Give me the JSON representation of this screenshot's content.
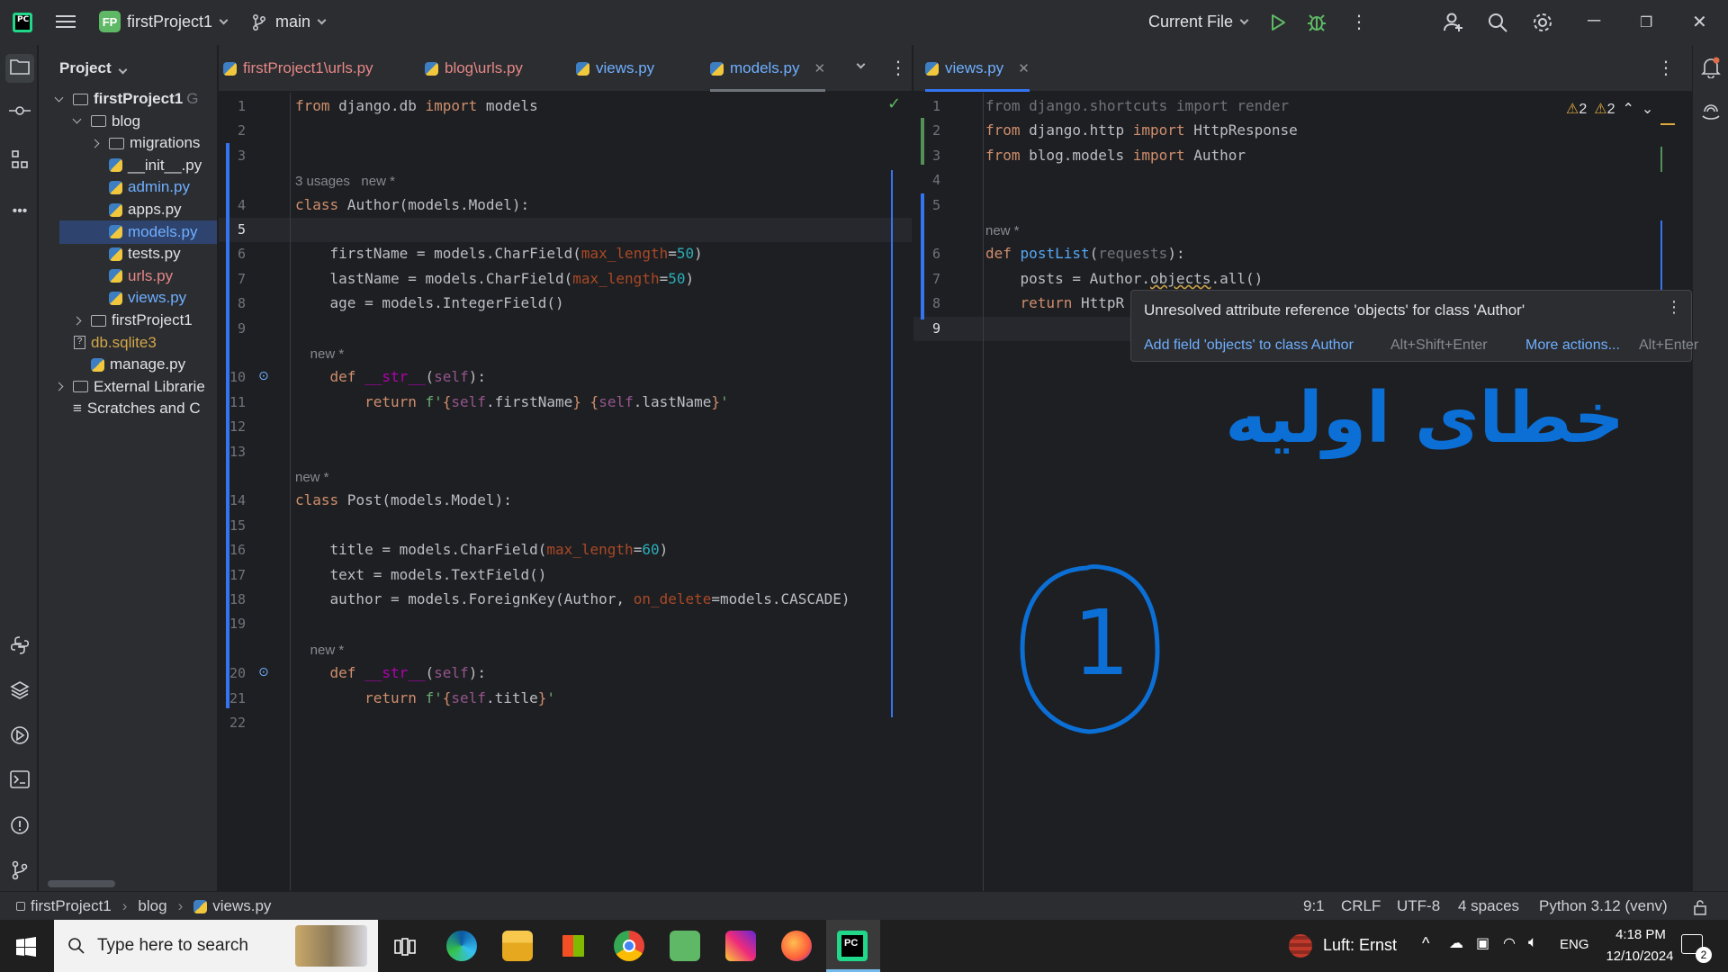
{
  "titlebar": {
    "project_badge": "FP",
    "project_name": "firstProject1",
    "branch": "main",
    "run_config": "Current File"
  },
  "project_panel": {
    "title": "Project",
    "tree": [
      {
        "label": "firstProject1",
        "suffix": "G",
        "level": 0,
        "kind": "folder",
        "expanded": true,
        "color": "normal",
        "bold": true
      },
      {
        "label": "blog",
        "level": 1,
        "kind": "folder",
        "expanded": true,
        "color": "normal"
      },
      {
        "label": "migrations",
        "level": 2,
        "kind": "folder",
        "expanded": false,
        "color": "normal"
      },
      {
        "label": "__init__.py",
        "level": 2,
        "kind": "py",
        "color": "normal"
      },
      {
        "label": "admin.py",
        "level": 2,
        "kind": "py",
        "color": "blue"
      },
      {
        "label": "apps.py",
        "level": 2,
        "kind": "py",
        "color": "normal"
      },
      {
        "label": "models.py",
        "level": 2,
        "kind": "py",
        "color": "blue",
        "selected": true
      },
      {
        "label": "tests.py",
        "level": 2,
        "kind": "py",
        "color": "normal"
      },
      {
        "label": "urls.py",
        "level": 2,
        "kind": "py",
        "color": "red"
      },
      {
        "label": "views.py",
        "level": 2,
        "kind": "py",
        "color": "blue"
      },
      {
        "label": "firstProject1",
        "level": 1,
        "kind": "folder",
        "expanded": false,
        "color": "normal"
      },
      {
        "label": "db.sqlite3",
        "level": 1,
        "kind": "db",
        "color": "gold"
      },
      {
        "label": "manage.py",
        "level": 1,
        "kind": "py",
        "color": "normal"
      },
      {
        "label": "External Librarie",
        "level": 0,
        "kind": "lib",
        "expanded": false,
        "color": "normal"
      },
      {
        "label": "Scratches and C",
        "level": 0,
        "kind": "scratch",
        "color": "normal"
      }
    ]
  },
  "editor_left": {
    "tabs": [
      {
        "label": "firstProject1\\urls.py",
        "color": "red"
      },
      {
        "label": "blog\\urls.py",
        "color": "red"
      },
      {
        "label": "views.py",
        "color": "blue"
      },
      {
        "label": "models.py",
        "color": "blue",
        "active": true,
        "close": "✕"
      }
    ],
    "lines": [
      {
        "n": "1",
        "html": "<span class='kw'>from</span> django.db <span class='kw'>import</span> models"
      },
      {
        "n": "2",
        "html": ""
      },
      {
        "n": "3",
        "html": ""
      },
      {
        "hint": "3 usages   new *"
      },
      {
        "n": "4",
        "html": "<span class='kw'>class</span> Author(models.Model):"
      },
      {
        "n": "5",
        "html": "",
        "current": true
      },
      {
        "n": "6",
        "html": "    firstName = models.CharField(<span class='pr'>max_length</span>=<span class='num'>50</span>)"
      },
      {
        "n": "7",
        "html": "    lastName = models.CharField(<span class='pr'>max_length</span>=<span class='num'>50</span>)"
      },
      {
        "n": "8",
        "html": "    age = models.IntegerField()"
      },
      {
        "n": "9",
        "html": ""
      },
      {
        "hint": "    new *"
      },
      {
        "n": "10",
        "html": "    <span class='kw'>def</span> <span class='dunder'>__str__</span>(<span class='slf'>self</span>):",
        "marker": true
      },
      {
        "n": "11",
        "html": "        <span class='kw'>return</span> <span class='st'>f'</span><span class='kw'>{</span><span class='slf'>self</span>.firstName<span class='kw'>}</span><span class='st'> </span><span class='kw'>{</span><span class='slf'>self</span>.lastName<span class='kw'>}</span><span class='st'>'</span>"
      },
      {
        "n": "12",
        "html": ""
      },
      {
        "n": "13",
        "html": ""
      },
      {
        "hint": "new *"
      },
      {
        "n": "14",
        "html": "<span class='kw'>class</span> Post(models.Model):"
      },
      {
        "n": "15",
        "html": ""
      },
      {
        "n": "16",
        "html": "    title = models.CharField(<span class='pr'>max_length</span>=<span class='num'>60</span>)"
      },
      {
        "n": "17",
        "html": "    text = models.TextField()"
      },
      {
        "n": "18",
        "html": "    author = models.ForeignKey(Author, <span class='pr'>on_delete</span>=models.CASCADE)"
      },
      {
        "n": "19",
        "html": ""
      },
      {
        "hint": "    new *"
      },
      {
        "n": "20",
        "html": "    <span class='kw'>def</span> <span class='dunder'>__str__</span>(<span class='slf'>self</span>):",
        "marker": true
      },
      {
        "n": "21",
        "html": "        <span class='kw'>return</span> <span class='st'>f'</span><span class='kw'>{</span><span class='slf'>self</span>.title<span class='kw'>}</span><span class='st'>'</span>"
      },
      {
        "n": "22",
        "html": ""
      }
    ]
  },
  "editor_right": {
    "tabs": [
      {
        "label": "views.py",
        "color": "blue",
        "active": true,
        "close": "✕"
      }
    ],
    "warnings": [
      "2",
      "2"
    ],
    "lines": [
      {
        "n": "1",
        "html": "<span class='dim'>from django.shortcuts import render</span>"
      },
      {
        "n": "2",
        "html": "<span class='kw'>from</span> django.http <span class='kw'>import</span> HttpResponse"
      },
      {
        "n": "3",
        "html": "<span class='kw'>from</span> blog.models <span class='kw'>import</span> Author"
      },
      {
        "n": "4",
        "html": ""
      },
      {
        "n": "5",
        "html": ""
      },
      {
        "hint": "new *"
      },
      {
        "n": "6",
        "html": "<span class='kw'>def</span> <span class='fn'>postList</span>(<span class='dim'>requests</span>):"
      },
      {
        "n": "7",
        "html": "    posts = Author.<span style='text-decoration:underline wavy #c9a14a'>objects</span>.all()"
      },
      {
        "n": "8",
        "html": "    <span class='kw'>return</span> HttpR"
      },
      {
        "n": "9",
        "html": "",
        "current": true
      }
    ]
  },
  "popup": {
    "message": "Unresolved attribute reference 'objects' for class 'Author'",
    "action": "Add field 'objects' to class Author",
    "action_shortcut": "Alt+Shift+Enter",
    "more": "More actions...",
    "more_shortcut": "Alt+Enter"
  },
  "annotation": {
    "persian_text": "خطای اولیه",
    "circled_number": "1"
  },
  "statusbar": {
    "breadcrumb": [
      "firstProject1",
      "blog",
      "views.py"
    ],
    "position": "9:1",
    "line_ending": "CRLF",
    "encoding": "UTF-8",
    "indent": "4 spaces",
    "interpreter": "Python 3.12 (venv)"
  },
  "taskbar": {
    "search_placeholder": "Type here to search",
    "weather": "Luft: Ernst",
    "lang": "ENG",
    "time": "4:18 PM",
    "date": "12/10/2024",
    "notif_count": "2"
  }
}
